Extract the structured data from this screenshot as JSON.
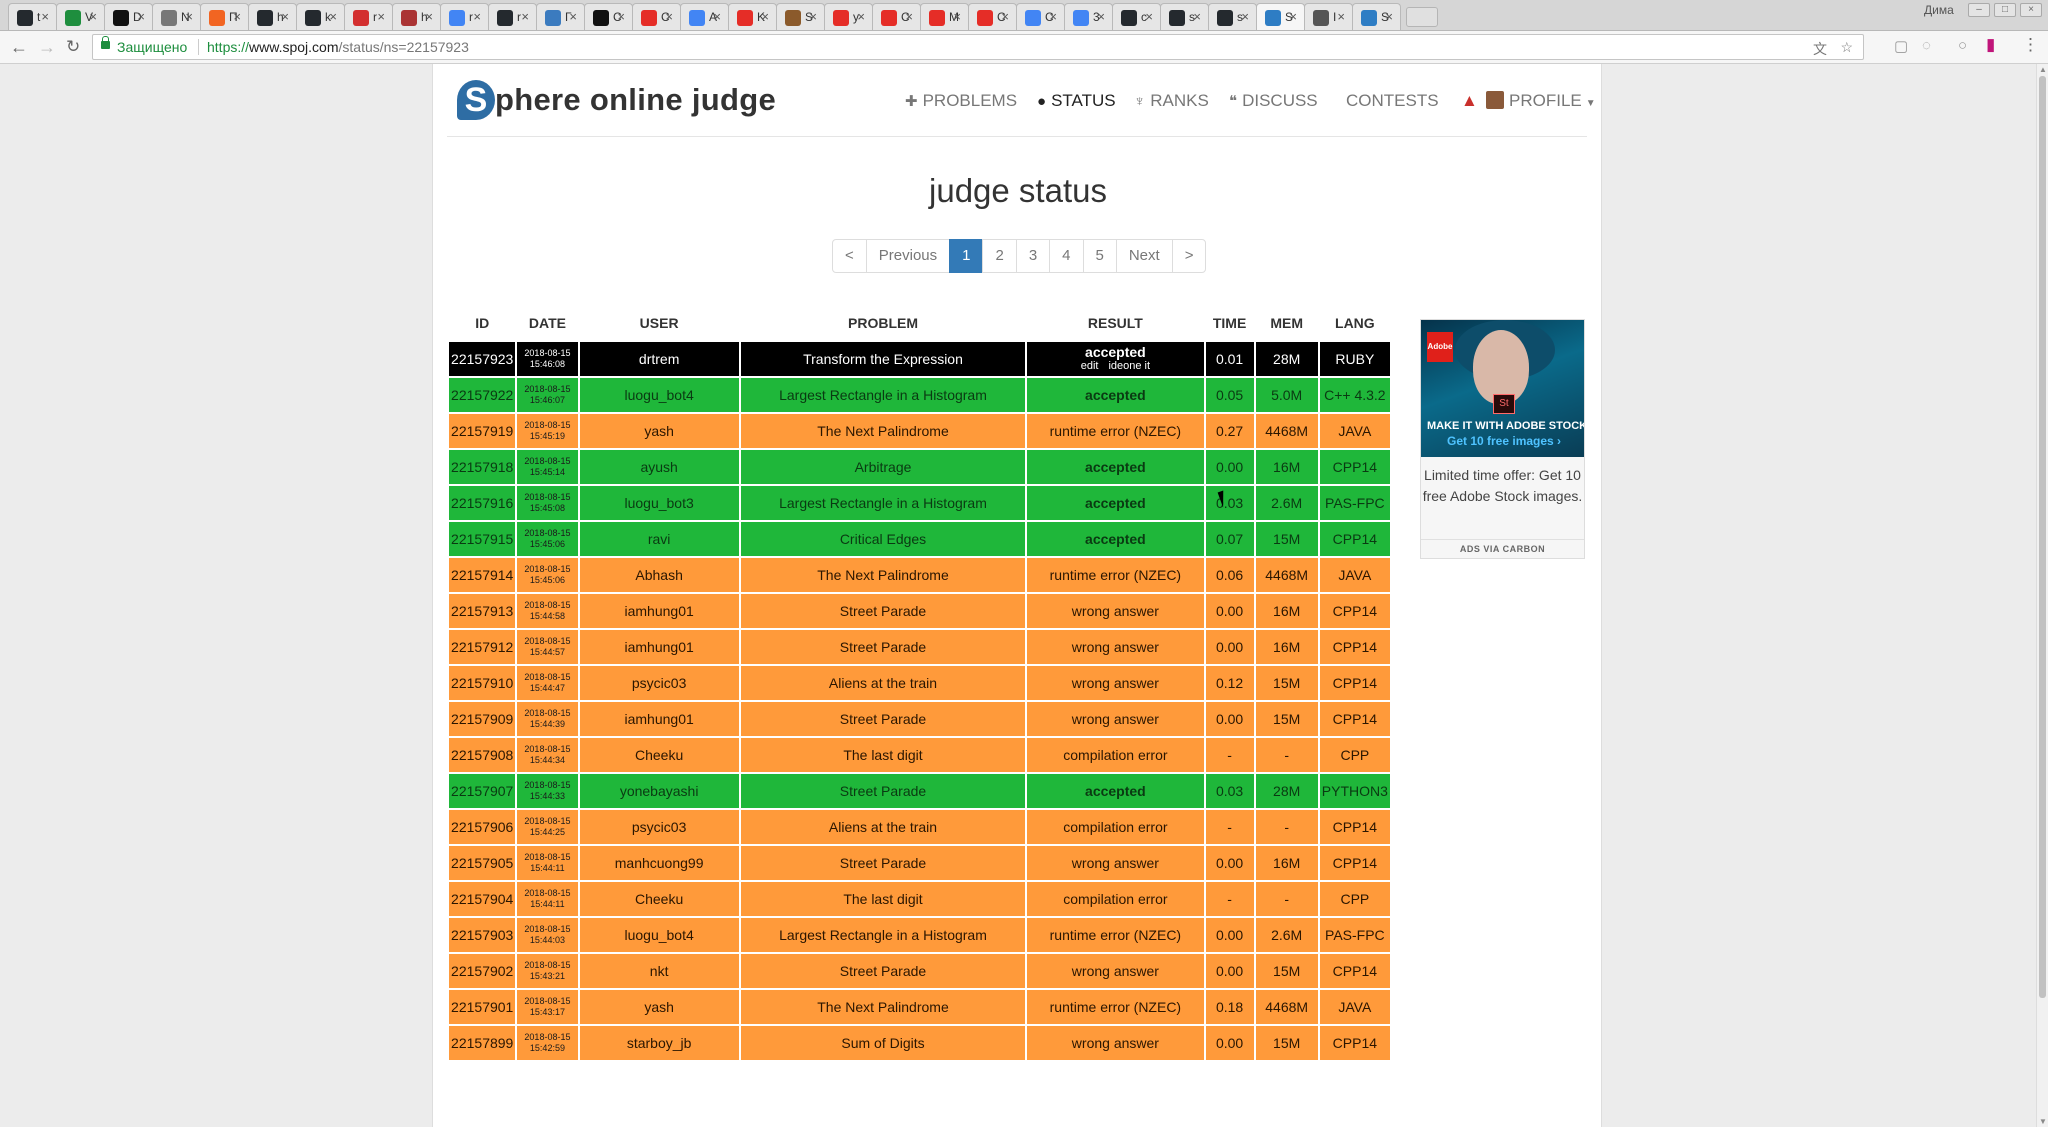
{
  "browser": {
    "tabs": [
      {
        "label": "t",
        "fav": "#24292e"
      },
      {
        "label": "V",
        "fav": "#1e8e3e"
      },
      {
        "label": "D",
        "fav": "#111"
      },
      {
        "label": "N",
        "fav": "#777"
      },
      {
        "label": "П",
        "fav": "#f26522"
      },
      {
        "label": "h",
        "fav": "#24292e"
      },
      {
        "label": "k",
        "fav": "#24292e"
      },
      {
        "label": "r",
        "fav": "#d32f2f"
      },
      {
        "label": "h",
        "fav": "#a33"
      },
      {
        "label": "r",
        "fav": "#4285f4"
      },
      {
        "label": "r",
        "fav": "#24292e"
      },
      {
        "label": "Г",
        "fav": "#3b7bbf"
      },
      {
        "label": "C",
        "fav": "#111"
      },
      {
        "label": "C",
        "fav": "#e52d27"
      },
      {
        "label": "A",
        "fav": "#4285f4"
      },
      {
        "label": "K",
        "fav": "#e52d27"
      },
      {
        "label": "S",
        "fav": "#8b5a2b"
      },
      {
        "label": "y",
        "fav": "#e52d27"
      },
      {
        "label": "C",
        "fav": "#e52d27"
      },
      {
        "label": "M",
        "fav": "#e52d27"
      },
      {
        "label": "C",
        "fav": "#e52d27"
      },
      {
        "label": "C",
        "fav": "#4285f4"
      },
      {
        "label": "3",
        "fav": "#4285f4"
      },
      {
        "label": "c",
        "fav": "#24292e"
      },
      {
        "label": "s",
        "fav": "#24292e"
      },
      {
        "label": "s",
        "fav": "#24292e"
      },
      {
        "label": "S",
        "fav": "#2e7dc4"
      },
      {
        "label": "I",
        "fav": "#555"
      },
      {
        "label": "S",
        "fav": "#2e7dc4"
      }
    ],
    "window_user": "Дима",
    "secure_label": "Защищено",
    "url_scheme": "https://",
    "url_host": "www.spoj.com",
    "url_path": "/status/ns=22157923"
  },
  "site": {
    "brand_letter": "S",
    "brand_rest": "phere online judge",
    "nav": {
      "problems": "PROBLEMS",
      "status": "STATUS",
      "ranks": "RANKS",
      "discuss": "DISCUSS",
      "contests": "CONTESTS",
      "profile": "PROFILE"
    }
  },
  "page": {
    "title": "judge status",
    "pager": {
      "first": "<",
      "prev": "Previous",
      "pages": [
        "1",
        "2",
        "3",
        "4",
        "5"
      ],
      "next": "Next",
      "last": ">"
    },
    "columns": [
      "ID",
      "DATE",
      "USER",
      "PROBLEM",
      "RESULT",
      "TIME",
      "MEM",
      "LANG"
    ],
    "rows": [
      {
        "id": "22157923",
        "date": "2018-08-15",
        "time_of_day": "15:46:08",
        "user": "drtrem",
        "problem": "Transform the Expression",
        "result": "accepted",
        "result_extra": [
          "edit",
          "ideone it"
        ],
        "time": "0.01",
        "mem": "28M",
        "lang": "RUBY",
        "style": "black"
      },
      {
        "id": "22157922",
        "date": "2018-08-15",
        "time_of_day": "15:46:07",
        "user": "luogu_bot4",
        "problem": "Largest Rectangle in a Histogram",
        "result": "accepted",
        "time": "0.05",
        "mem": "5.0M",
        "lang": "C++ 4.3.2",
        "style": "green"
      },
      {
        "id": "22157919",
        "date": "2018-08-15",
        "time_of_day": "15:45:19",
        "user": "yash",
        "problem": "The Next Palindrome",
        "result": "runtime error (NZEC)",
        "time": "0.27",
        "mem": "4468M",
        "lang": "JAVA",
        "style": "orange"
      },
      {
        "id": "22157918",
        "date": "2018-08-15",
        "time_of_day": "15:45:14",
        "user": "ayush",
        "problem": "Arbitrage",
        "result": "accepted",
        "time": "0.00",
        "mem": "16M",
        "lang": "CPP14",
        "style": "green"
      },
      {
        "id": "22157916",
        "date": "2018-08-15",
        "time_of_day": "15:45:08",
        "user": "luogu_bot3",
        "problem": "Largest Rectangle in a Histogram",
        "result": "accepted",
        "time": "0.03",
        "mem": "2.6M",
        "lang": "PAS-FPC",
        "style": "green"
      },
      {
        "id": "22157915",
        "date": "2018-08-15",
        "time_of_day": "15:45:06",
        "user": "ravi",
        "problem": "Critical Edges",
        "result": "accepted",
        "time": "0.07",
        "mem": "15M",
        "lang": "CPP14",
        "style": "green"
      },
      {
        "id": "22157914",
        "date": "2018-08-15",
        "time_of_day": "15:45:06",
        "user": "Abhash",
        "problem": "The Next Palindrome",
        "result": "runtime error (NZEC)",
        "time": "0.06",
        "mem": "4468M",
        "lang": "JAVA",
        "style": "orange"
      },
      {
        "id": "22157913",
        "date": "2018-08-15",
        "time_of_day": "15:44:58",
        "user": "iamhung01",
        "problem": "Street Parade",
        "result": "wrong answer",
        "time": "0.00",
        "mem": "16M",
        "lang": "CPP14",
        "style": "orange"
      },
      {
        "id": "22157912",
        "date": "2018-08-15",
        "time_of_day": "15:44:57",
        "user": "iamhung01",
        "problem": "Street Parade",
        "result": "wrong answer",
        "time": "0.00",
        "mem": "16M",
        "lang": "CPP14",
        "style": "orange"
      },
      {
        "id": "22157910",
        "date": "2018-08-15",
        "time_of_day": "15:44:47",
        "user": "psycic03",
        "problem": "Aliens at the train",
        "result": "wrong answer",
        "time": "0.12",
        "mem": "15M",
        "lang": "CPP14",
        "style": "orange"
      },
      {
        "id": "22157909",
        "date": "2018-08-15",
        "time_of_day": "15:44:39",
        "user": "iamhung01",
        "problem": "Street Parade",
        "result": "wrong answer",
        "time": "0.00",
        "mem": "15M",
        "lang": "CPP14",
        "style": "orange"
      },
      {
        "id": "22157908",
        "date": "2018-08-15",
        "time_of_day": "15:44:34",
        "user": "Cheeku",
        "problem": "The last digit",
        "result": "compilation error",
        "time": "-",
        "mem": "-",
        "lang": "CPP",
        "style": "orange"
      },
      {
        "id": "22157907",
        "date": "2018-08-15",
        "time_of_day": "15:44:33",
        "user": "yonebayashi",
        "problem": "Street Parade",
        "result": "accepted",
        "time": "0.03",
        "mem": "28M",
        "lang": "PYTHON3",
        "style": "green"
      },
      {
        "id": "22157906",
        "date": "2018-08-15",
        "time_of_day": "15:44:25",
        "user": "psycic03",
        "problem": "Aliens at the train",
        "result": "compilation error",
        "time": "-",
        "mem": "-",
        "lang": "CPP14",
        "style": "orange"
      },
      {
        "id": "22157905",
        "date": "2018-08-15",
        "time_of_day": "15:44:11",
        "user": "manhcuong99",
        "problem": "Street Parade",
        "result": "wrong answer",
        "time": "0.00",
        "mem": "16M",
        "lang": "CPP14",
        "style": "orange"
      },
      {
        "id": "22157904",
        "date": "2018-08-15",
        "time_of_day": "15:44:11",
        "user": "Cheeku",
        "problem": "The last digit",
        "result": "compilation error",
        "time": "-",
        "mem": "-",
        "lang": "CPP",
        "style": "orange"
      },
      {
        "id": "22157903",
        "date": "2018-08-15",
        "time_of_day": "15:44:03",
        "user": "luogu_bot4",
        "problem": "Largest Rectangle in a Histogram",
        "result": "runtime error (NZEC)",
        "time": "0.00",
        "mem": "2.6M",
        "lang": "PAS-FPC",
        "style": "orange"
      },
      {
        "id": "22157902",
        "date": "2018-08-15",
        "time_of_day": "15:43:21",
        "user": "nkt",
        "problem": "Street Parade",
        "result": "wrong answer",
        "time": "0.00",
        "mem": "15M",
        "lang": "CPP14",
        "style": "orange"
      },
      {
        "id": "22157901",
        "date": "2018-08-15",
        "time_of_day": "15:43:17",
        "user": "yash",
        "problem": "The Next Palindrome",
        "result": "runtime error (NZEC)",
        "time": "0.18",
        "mem": "4468M",
        "lang": "JAVA",
        "style": "orange"
      },
      {
        "id": "22157899",
        "date": "2018-08-15",
        "time_of_day": "15:42:59",
        "user": "starboy_jb",
        "problem": "Sum of Digits",
        "result": "wrong answer",
        "time": "0.00",
        "mem": "15M",
        "lang": "CPP14",
        "style": "orange"
      }
    ]
  },
  "ad": {
    "brand": "Adobe",
    "product_badge": "St",
    "headline": "MAKE IT WITH ADOBE STOCK",
    "cta": "Get 10 free images ›",
    "body": "Limited time offer: Get 10 free Adobe Stock images.",
    "via": "ADS VIA CARBON"
  },
  "colors": {
    "accepted_row": "#1fb73a",
    "error_row": "#ff9a3a",
    "latest_row": "#000000",
    "pager_active": "#337ab7"
  }
}
